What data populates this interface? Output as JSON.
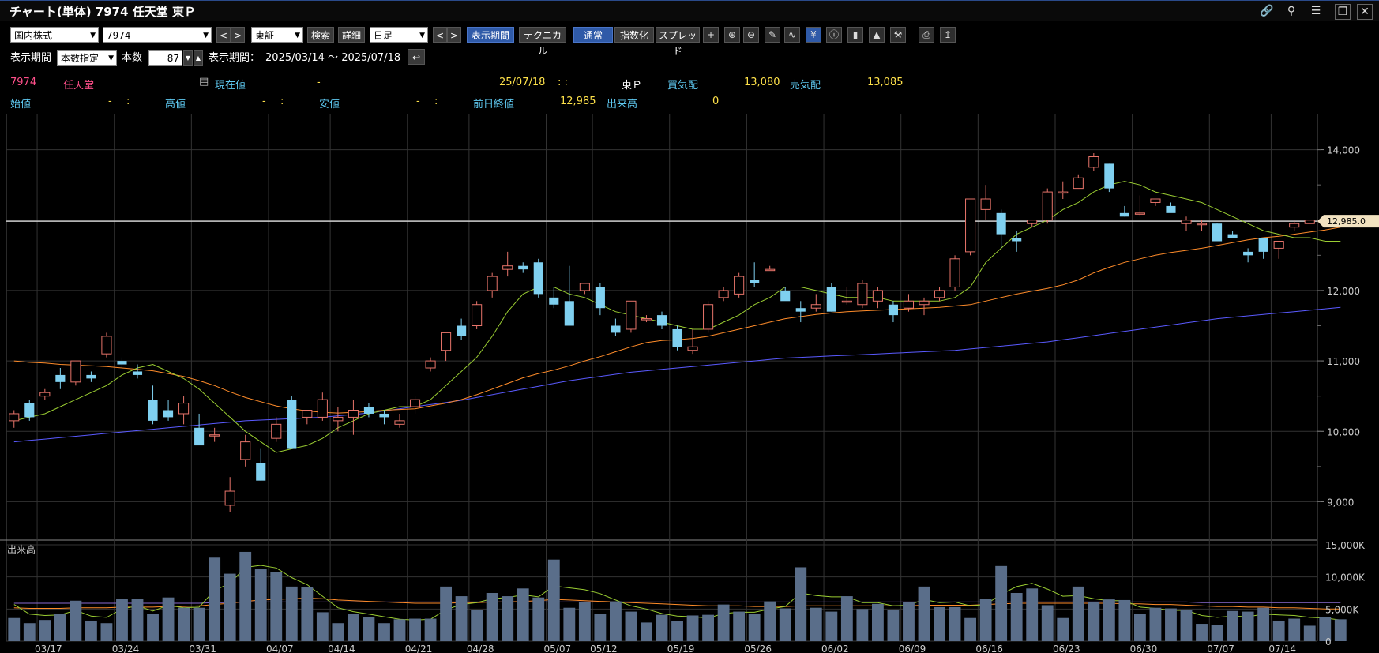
{
  "window": {
    "title": "チャート(単体) 7974 任天堂 東Ｐ"
  },
  "toolbar": {
    "market": "国内株式",
    "code": "7974",
    "exchange": "東証",
    "search_label": "検索",
    "detail_label": "詳細",
    "period_type": "日足",
    "display_period_label": "表示期間",
    "technical_label": "テクニカル",
    "normal_label": "通常",
    "index_label": "指数化",
    "spread_label": "スプレッド"
  },
  "period": {
    "label": "表示期間",
    "mode": "本数指定",
    "count_label": "本数",
    "count_value": "87",
    "range_label": "表示期間：",
    "range_value": "2025/03/14 ～ 2025/07/18"
  },
  "quote": {
    "code": "7974",
    "name": "任天堂",
    "current_label": "現在値",
    "current_value": "-",
    "date": "25/07/18",
    "time": ": :",
    "market": "東Ｐ",
    "bid_label": "買気配",
    "bid_value": "13,080",
    "ask_label": "売気配",
    "ask_value": "13,085",
    "open_label": "始値",
    "open_value": "-",
    "open_time": ":",
    "high_label": "高値",
    "high_value": "-",
    "high_time": ":",
    "low_label": "安値",
    "low_value": "-",
    "low_time": ":",
    "prev_close_label": "前日終値",
    "prev_close_value": "12,985",
    "volume_label": "出来高",
    "volume_value": "0"
  },
  "colors": {
    "up": "#e8746a",
    "down": "#7fd0f0",
    "ma_short": "#9acd32",
    "ma_mid": "#ff8c2a",
    "ma_long": "#5a5aff",
    "volume_bar": "#5a6e8a"
  },
  "chart_data": {
    "type": "candlestick",
    "price_axis": {
      "ticks": [
        9000,
        10000,
        11000,
        12000,
        13000,
        14000
      ],
      "tick_labels": [
        "9,000",
        "10,000",
        "11,000",
        "12,000",
        "13,000",
        "14,000"
      ],
      "ylim": [
        8500,
        14500
      ]
    },
    "price_marker": "12,985.0",
    "price_marker_value": 12985,
    "volume_label": "出来高",
    "volume_axis": {
      "ticks": [
        0,
        5000,
        10000,
        15000
      ],
      "tick_labels": [
        "0",
        "5,000K",
        "10,000K",
        "15,000K"
      ]
    },
    "date_labels": [
      "03/17",
      "03/24",
      "03/31",
      "04/07",
      "04/14",
      "04/21",
      "04/28",
      "05/07",
      "05/12",
      "05/19",
      "05/26",
      "06/02",
      "06/09",
      "06/16",
      "06/23",
      "06/30",
      "07/07",
      "07/14"
    ],
    "candles": [
      [
        10150,
        10300,
        10050,
        10250
      ],
      [
        10400,
        10450,
        10150,
        10200
      ],
      [
        10500,
        10600,
        10450,
        10550
      ],
      [
        10800,
        10900,
        10600,
        10700
      ],
      [
        10700,
        11000,
        10650,
        11000
      ],
      [
        10800,
        10850,
        10700,
        10750
      ],
      [
        11100,
        11400,
        11050,
        11350
      ],
      [
        11000,
        11050,
        10900,
        10950
      ],
      [
        10850,
        10950,
        10750,
        10800
      ],
      [
        10450,
        10650,
        10100,
        10150
      ],
      [
        10300,
        10450,
        10150,
        10200
      ],
      [
        10250,
        10500,
        10100,
        10400
      ],
      [
        10050,
        10250,
        9850,
        9800
      ],
      [
        9950,
        10050,
        9850,
        9950
      ],
      [
        8950,
        9350,
        8850,
        9150
      ],
      [
        9600,
        9950,
        9500,
        9850
      ],
      [
        9550,
        9750,
        9300,
        9300
      ],
      [
        9900,
        10200,
        9850,
        10100
      ],
      [
        10450,
        10500,
        9800,
        9750
      ],
      [
        10200,
        10300,
        10100,
        10300
      ],
      [
        10200,
        10550,
        10150,
        10450
      ],
      [
        10150,
        10350,
        10000,
        10200
      ],
      [
        10200,
        10450,
        9950,
        10300
      ],
      [
        10350,
        10400,
        10200,
        10250
      ],
      [
        10250,
        10300,
        10100,
        10200
      ],
      [
        10100,
        10250,
        10050,
        10150
      ],
      [
        10350,
        10500,
        10250,
        10450
      ],
      [
        10900,
        11050,
        10850,
        11000
      ],
      [
        11150,
        11400,
        11000,
        11400
      ],
      [
        11500,
        11600,
        11300,
        11350
      ],
      [
        11500,
        11850,
        11450,
        11800
      ],
      [
        12000,
        12250,
        11900,
        12200
      ],
      [
        12300,
        12550,
        12200,
        12350
      ],
      [
        12350,
        12400,
        12250,
        12300
      ],
      [
        12400,
        12450,
        11900,
        11950
      ],
      [
        11900,
        12050,
        11750,
        11800
      ],
      [
        11850,
        12350,
        11550,
        11500
      ],
      [
        12000,
        12100,
        11950,
        12100
      ],
      [
        12050,
        12100,
        11650,
        11750
      ],
      [
        11500,
        11600,
        11350,
        11400
      ],
      [
        11450,
        11850,
        11400,
        11850
      ],
      [
        11600,
        11650,
        11550,
        11600
      ],
      [
        11650,
        11700,
        11450,
        11500
      ],
      [
        11450,
        11500,
        11150,
        11200
      ],
      [
        11150,
        11450,
        11100,
        11200
      ],
      [
        11450,
        11850,
        11400,
        11800
      ],
      [
        11900,
        12050,
        11850,
        12000
      ],
      [
        11950,
        12250,
        11900,
        12200
      ],
      [
        12150,
        12400,
        12050,
        12100
      ],
      [
        12300,
        12350,
        12300,
        12300
      ],
      [
        12000,
        12050,
        11900,
        11850
      ],
      [
        11750,
        11850,
        11550,
        11700
      ],
      [
        11750,
        11950,
        11700,
        11800
      ],
      [
        12050,
        12100,
        11700,
        11700
      ],
      [
        11850,
        12050,
        11800,
        11850
      ],
      [
        11800,
        12150,
        11750,
        12100
      ],
      [
        11850,
        12050,
        11750,
        12000
      ],
      [
        11800,
        11850,
        11550,
        11650
      ],
      [
        11750,
        11950,
        11700,
        11850
      ],
      [
        11800,
        11900,
        11650,
        11850
      ],
      [
        11900,
        12050,
        11850,
        12000
      ],
      [
        12050,
        12500,
        12000,
        12450
      ],
      [
        12550,
        13300,
        12500,
        13300
      ],
      [
        13150,
        13500,
        13000,
        13300
      ],
      [
        13100,
        13150,
        12600,
        12800
      ],
      [
        12750,
        12850,
        12550,
        12700
      ],
      [
        12950,
        13000,
        12900,
        13000
      ],
      [
        13000,
        13450,
        12950,
        13400
      ],
      [
        13400,
        13550,
        13300,
        13400
      ],
      [
        13450,
        13650,
        13450,
        13600
      ],
      [
        13750,
        13950,
        13700,
        13900
      ],
      [
        13800,
        13800,
        13400,
        13450
      ],
      [
        13100,
        13200,
        13050,
        13050
      ],
      [
        13100,
        13350,
        13050,
        13100
      ],
      [
        13250,
        13300,
        13200,
        13300
      ],
      [
        13200,
        13250,
        13150,
        13100
      ],
      [
        12950,
        13050,
        12850,
        13000
      ],
      [
        12950,
        13000,
        12850,
        12950
      ],
      [
        12950,
        12950,
        12700,
        12700
      ],
      [
        12800,
        12850,
        12750,
        12750
      ],
      [
        12550,
        12600,
        12400,
        12500
      ],
      [
        12750,
        12750,
        12450,
        12550
      ],
      [
        12600,
        12700,
        12450,
        12700
      ],
      [
        12900,
        13000,
        12850,
        12950
      ],
      [
        12950,
        13000,
        12950,
        13000
      ]
    ],
    "ma_short": [
      10150,
      10200,
      10250,
      10350,
      10450,
      10550,
      10650,
      10800,
      10900,
      10950,
      10850,
      10750,
      10600,
      10400,
      10200,
      10000,
      9850,
      9700,
      9750,
      9800,
      9900,
      10050,
      10150,
      10250,
      10300,
      10350,
      10350,
      10450,
      10650,
      10850,
      11050,
      11350,
      11700,
      11950,
      12050,
      12050,
      11950,
      11900,
      11800,
      11700,
      11650,
      11600,
      11550,
      11500,
      11450,
      11450,
      11550,
      11650,
      11800,
      11900,
      12050,
      12050,
      12000,
      11950,
      11900,
      11900,
      11900,
      11850,
      11850,
      11850,
      11850,
      11900,
      12050,
      12400,
      12600,
      12800,
      12900,
      13000,
      13150,
      13250,
      13400,
      13500,
      13550,
      13500,
      13400,
      13350,
      13300,
      13250,
      13150,
      13050,
      12950,
      12850,
      12800,
      12750,
      12750,
      12700,
      12700
    ],
    "ma_mid": [
      11000,
      10980,
      10970,
      10950,
      10940,
      10930,
      10920,
      10900,
      10880,
      10860,
      10820,
      10780,
      10720,
      10650,
      10560,
      10480,
      10420,
      10360,
      10320,
      10290,
      10270,
      10260,
      10270,
      10280,
      10300,
      10310,
      10320,
      10360,
      10400,
      10450,
      10520,
      10600,
      10680,
      10760,
      10820,
      10870,
      10930,
      11000,
      11060,
      11130,
      11200,
      11260,
      11290,
      11300,
      11320,
      11350,
      11400,
      11450,
      11500,
      11550,
      11600,
      11630,
      11660,
      11680,
      11700,
      11710,
      11720,
      11730,
      11740,
      11750,
      11760,
      11780,
      11800,
      11850,
      11900,
      11950,
      11990,
      12030,
      12080,
      12150,
      12250,
      12330,
      12400,
      12450,
      12500,
      12540,
      12570,
      12600,
      12640,
      12680,
      12720,
      12750,
      12770,
      12800,
      12830,
      12860,
      12900
    ],
    "ma_long": [
      9850,
      9870,
      9890,
      9910,
      9930,
      9950,
      9970,
      9990,
      10010,
      10030,
      10050,
      10070,
      10090,
      10110,
      10130,
      10150,
      10160,
      10170,
      10180,
      10190,
      10200,
      10220,
      10240,
      10260,
      10290,
      10320,
      10350,
      10380,
      10410,
      10440,
      10480,
      10520,
      10560,
      10600,
      10640,
      10680,
      10720,
      10750,
      10780,
      10810,
      10840,
      10860,
      10880,
      10900,
      10920,
      10940,
      10960,
      10980,
      11000,
      11020,
      11040,
      11050,
      11060,
      11070,
      11080,
      11090,
      11100,
      11110,
      11120,
      11130,
      11140,
      11150,
      11170,
      11190,
      11210,
      11230,
      11250,
      11270,
      11300,
      11330,
      11360,
      11390,
      11420,
      11450,
      11480,
      11510,
      11540,
      11570,
      11600,
      11620,
      11640,
      11660,
      11680,
      11700,
      11720,
      11740,
      11760
    ],
    "volume": [
      3600,
      2800,
      3300,
      4200,
      6300,
      3200,
      2800,
      6600,
      6600,
      4300,
      6800,
      5200,
      5200,
      13000,
      10500,
      13900,
      11200,
      10700,
      8500,
      8400,
      4500,
      2800,
      4200,
      3800,
      2800,
      3400,
      3500,
      3500,
      8500,
      7000,
      4900,
      7500,
      7000,
      8200,
      6800,
      12700,
      5200,
      6100,
      4300,
      6200,
      4600,
      2900,
      4100,
      3100,
      4000,
      4100,
      5700,
      4600,
      4200,
      6200,
      5100,
      11500,
      5200,
      4600,
      7000,
      5000,
      5800,
      4800,
      6100,
      8500,
      5300,
      5300,
      3600,
      6600,
      11700,
      7500,
      8200,
      5600,
      3600,
      8500,
      6100,
      6500,
      6400,
      4200,
      5200,
      5100,
      4900,
      2700,
      2500,
      4700,
      4600,
      5200,
      3200,
      3500,
      2400,
      3800,
      3400
    ],
    "vol_ma_short": [
      5700,
      4200,
      4000,
      4100,
      4800,
      3900,
      3700,
      5000,
      5500,
      4700,
      5600,
      5200,
      5300,
      7900,
      9000,
      11500,
      11800,
      11400,
      9900,
      8800,
      7000,
      5200,
      4600,
      4200,
      3800,
      3400,
      3300,
      3400,
      4900,
      5700,
      6000,
      6600,
      6800,
      7200,
      6900,
      8600,
      8300,
      8000,
      7400,
      6400,
      5500,
      5000,
      4300,
      3900,
      3800,
      3600,
      4300,
      4500,
      4500,
      5000,
      5400,
      7500,
      7100,
      6900,
      6900,
      6000,
      6000,
      5500,
      5600,
      6500,
      6000,
      6100,
      5500,
      5700,
      7300,
      8500,
      9000,
      8100,
      7000,
      7100,
      6600,
      6300,
      6300,
      5300,
      5100,
      4800,
      4800,
      4000,
      3700,
      3900,
      3800,
      4200,
      4100,
      4000,
      3700,
      3600,
      3300
    ],
    "vol_ma_mid": [
      5200,
      5100,
      5100,
      5100,
      5200,
      5200,
      5200,
      5300,
      5300,
      5300,
      5400,
      5400,
      5500,
      5700,
      5900,
      6200,
      6400,
      6500,
      6600,
      6700,
      6600,
      6400,
      6300,
      6200,
      6100,
      6000,
      5900,
      5900,
      5900,
      6000,
      6000,
      6100,
      6100,
      6200,
      6300,
      6500,
      6400,
      6300,
      6200,
      6100,
      6000,
      5900,
      5800,
      5700,
      5600,
      5500,
      5500,
      5500,
      5400,
      5400,
      5400,
      5500,
      5500,
      5500,
      5500,
      5500,
      5500,
      5500,
      5500,
      5600,
      5600,
      5600,
      5600,
      5700,
      5800,
      5900,
      5900,
      5900,
      5900,
      5900,
      5900,
      5900,
      5800,
      5800,
      5700,
      5700,
      5600,
      5500,
      5400,
      5400,
      5300,
      5300,
      5200,
      5200,
      5100,
      5000,
      5000
    ],
    "vol_ma_long": [
      5900,
      5900,
      5900,
      5900,
      5900,
      5900,
      5900,
      5900,
      5900,
      5900,
      5900,
      5900,
      5900,
      6000,
      6000,
      6100,
      6100,
      6100,
      6100,
      6100,
      6100,
      6100,
      6100,
      6100,
      6100,
      6100,
      6100,
      6100,
      6100,
      6100,
      6100,
      6100,
      6100,
      6100,
      6100,
      6100,
      6100,
      6100,
      6100,
      6100,
      6100,
      6100,
      6100,
      6100,
      6100,
      6100,
      6100,
      6100,
      6100,
      6100,
      6100,
      6100,
      6100,
      6100,
      6100,
      6100,
      6100,
      6100,
      6100,
      6100,
      6100,
      6100,
      6100,
      6100,
      6100,
      6100,
      6100,
      6100,
      6100,
      6100,
      6100,
      6100,
      6100,
      6100,
      6100,
      6100,
      6100,
      6000,
      6000,
      6000,
      6000,
      6000,
      6000,
      6000,
      6000,
      6000,
      6000
    ]
  }
}
